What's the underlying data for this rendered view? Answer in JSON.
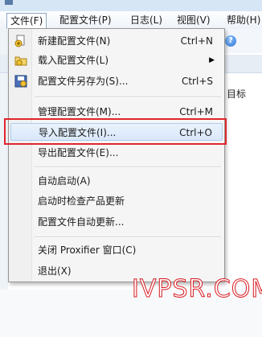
{
  "menubar": {
    "items": [
      {
        "label": "文件(F)",
        "active": true
      },
      {
        "label": "配置文件(P)",
        "active": false
      },
      {
        "label": "日志(L)",
        "active": false
      },
      {
        "label": "视图(V)",
        "active": false
      },
      {
        "label": "帮助(H)",
        "active": false
      }
    ]
  },
  "background": {
    "target_text": "目标",
    "help_icon": "help-icon"
  },
  "file_menu": {
    "items": [
      {
        "label": "新建配置文件(N)",
        "accel": "Ctrl+N",
        "icon": "new-profile-icon"
      },
      {
        "label": "载入配置文件(L)",
        "accel": "",
        "icon": "load-profile-icon",
        "submenu": true
      },
      {
        "label": "配置文件另存为(S)...",
        "accel": "Ctrl+S",
        "icon": "save-as-icon"
      },
      {
        "label": "管理配置文件(M)...",
        "accel": "Ctrl+M"
      },
      {
        "label": "导入配置文件(I)...",
        "accel": "Ctrl+O",
        "highlighted": true
      },
      {
        "label": "导出配置文件(E)...",
        "accel": ""
      },
      {
        "label": "自动启动(A)",
        "accel": ""
      },
      {
        "label": "启动时检查产品更新",
        "accel": ""
      },
      {
        "label": "配置文件自动更新...",
        "accel": ""
      },
      {
        "label": "关闭 Proxifier 窗口(C)",
        "accel": ""
      },
      {
        "label": "退出(X)",
        "accel": ""
      }
    ],
    "submenu_arrow": "▶"
  },
  "watermark": "IVPSR.COM",
  "colors": {
    "highlight_box": "#e0262b",
    "watermark": "#d81b21"
  }
}
